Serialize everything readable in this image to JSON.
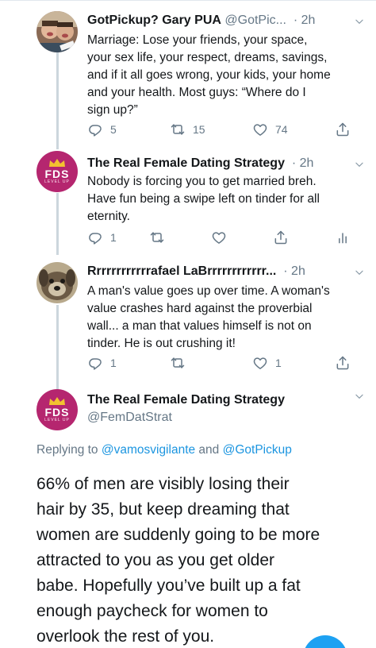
{
  "colors": {
    "accent": "#1da1f2",
    "link": "#1b95e0",
    "muted": "#657786",
    "fds_brand": "#b5266f"
  },
  "tweets": [
    {
      "name": "GotPickup? Gary PUA",
      "handle": "@GotPic...",
      "dot": "·",
      "time": "2h",
      "avatar_icon": "two-men-photo",
      "lines": [
        "Marriage: Lose your friends, your space,",
        "your sex life, your respect, dreams, savings,",
        "and if it all goes wrong, your kids, your home",
        "and your health. Most guys: “Where do I",
        "sign up?”"
      ],
      "actions": {
        "replies": "5",
        "retweets": "15",
        "likes": "74"
      }
    },
    {
      "name": "The Real Female Dating Strategy",
      "handle": "",
      "dot": "·",
      "time": "2h",
      "avatar_icon": "fds-crown-logo",
      "lines": [
        "Nobody is forcing you to get married breh.",
        "Have fun being a swipe left on tinder for all",
        "eternity."
      ],
      "actions": {
        "replies": "1",
        "retweets": "",
        "likes": ""
      }
    },
    {
      "name": "Rrrrrrrrrrrrafael LaBrrrrrrrrrrrr...",
      "handle": "",
      "dot": "·",
      "time": "2h",
      "avatar_icon": "dog-photo",
      "lines": [
        "A man's value goes up over time.  A woman's",
        "value crashes hard against the proverbial",
        "wall... a man that values himself is not on",
        "tinder.  He is out crushing it!"
      ],
      "actions": {
        "replies": "1",
        "retweets": "",
        "likes": "1"
      }
    }
  ],
  "main_tweet": {
    "name": "The Real Female Dating Strategy",
    "handle": "@FemDatStrat",
    "avatar_icon": "fds-crown-logo",
    "replying_prefix": "Replying to ",
    "replying_user1": "@vamosvigilante",
    "replying_and": " and ",
    "replying_user2": "@GotPickup",
    "lines": [
      "66% of men are visibly losing their",
      "hair by 35, but keep dreaming that",
      "women are suddenly going to be more",
      "attracted to you as you get older",
      "babe. Hopefully you’ve built up a fat",
      "enough paycheck for women to",
      "overlook the rest of you."
    ]
  },
  "logo_text": {
    "fds": "FDS",
    "level_up": "LEVEL UP"
  }
}
